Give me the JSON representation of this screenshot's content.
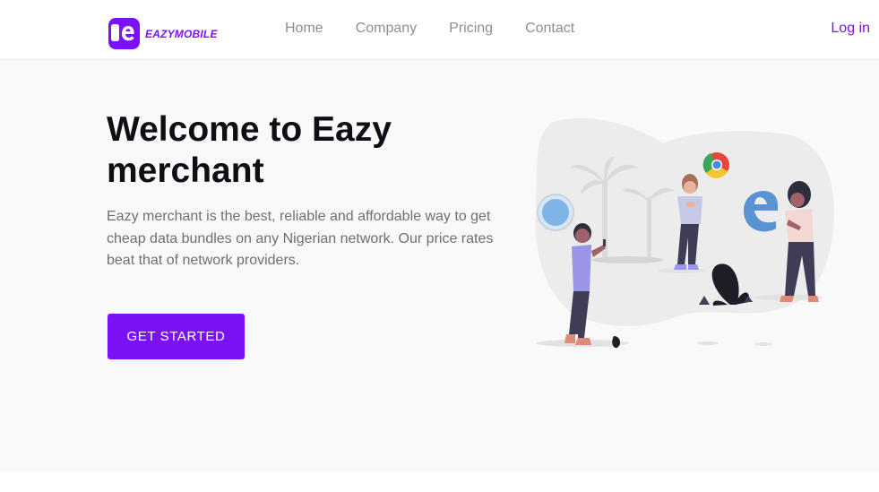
{
  "brand": {
    "name": "EAZYMOBILE",
    "color": "#7b12f5"
  },
  "nav": {
    "items": [
      {
        "label": "Home"
      },
      {
        "label": "Company"
      },
      {
        "label": "Pricing"
      },
      {
        "label": "Contact"
      }
    ],
    "login_label": "Log in"
  },
  "hero": {
    "title": "Welcome to Eazy merchant",
    "description": "Eazy merchant is the best, reliable and affordable way to get cheap data bundles on any Nigerian network. Our price rates beat that of network providers.",
    "cta_label": "GET STARTED"
  },
  "illustration": {
    "icons": [
      "safari-icon",
      "chrome-icon",
      "edge-icon"
    ]
  }
}
